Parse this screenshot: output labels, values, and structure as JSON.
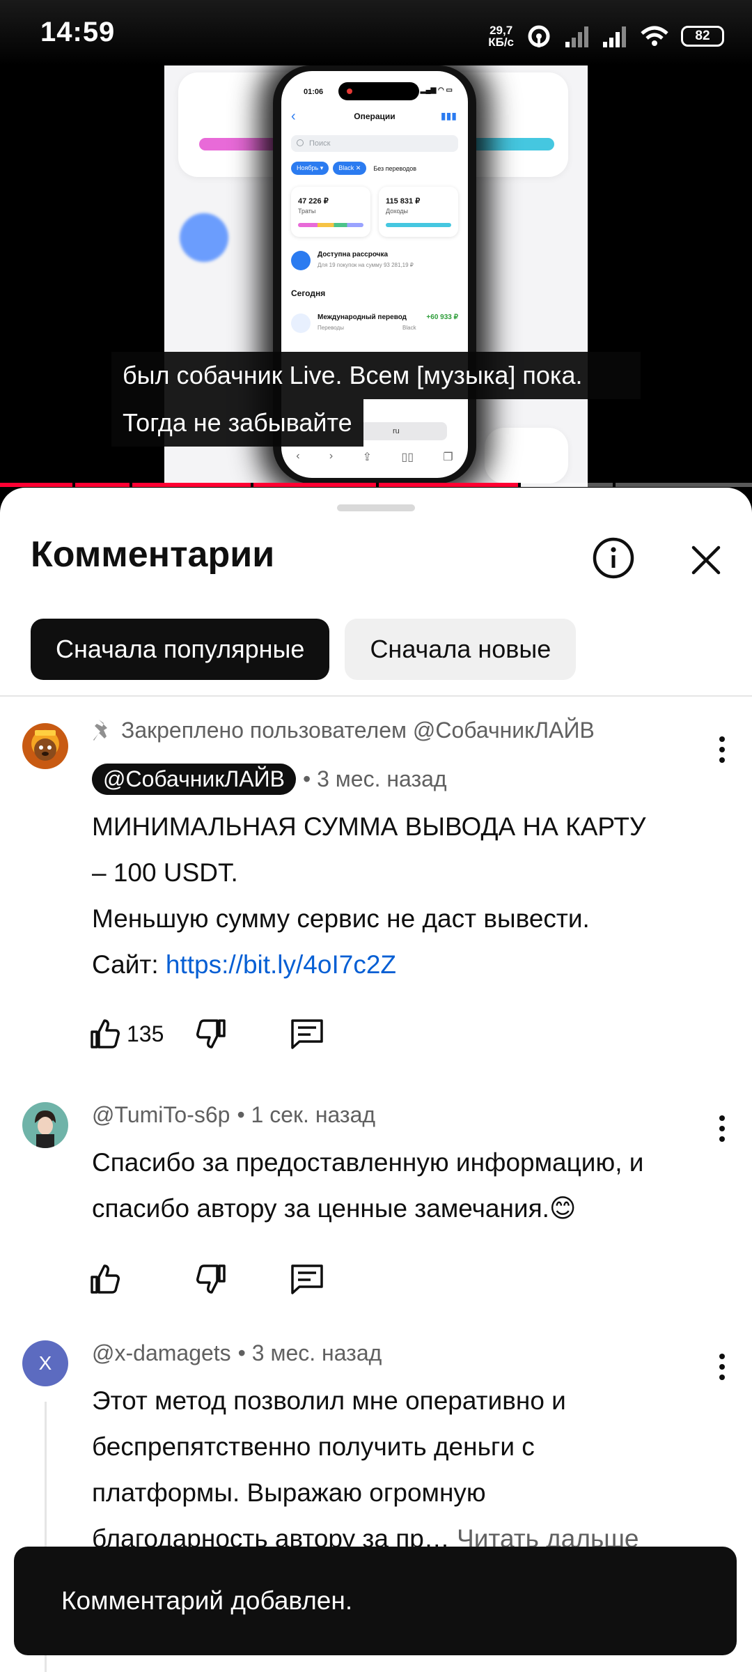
{
  "status_bar": {
    "time": "14:59",
    "net_speed_value": "29,7",
    "net_speed_unit": "КБ/с",
    "battery": "82"
  },
  "video": {
    "phone": {
      "time": "01:06",
      "title": "Операции",
      "search_placeholder": "Поиск",
      "chips": [
        "Ноябрь ▾",
        "Black ✕"
      ],
      "chip_plain": "Без переводов",
      "card_spend_value": "47 226 ₽",
      "card_spend_label": "Траты",
      "card_income_value": "115 831 ₽",
      "card_income_label": "Доходы",
      "installment_title": "Доступна рассрочка",
      "installment_sub": "Для 19 покупок на сумму 93 281,19 ₽",
      "section_today": "Сегодня",
      "transfer_title": "Международный перевод",
      "transfer_sub": "Переводы",
      "transfer_amount": "+60 933 ₽",
      "transfer_card": "Black",
      "url_text": "ru"
    },
    "subtitle_line1": "был собачник Live. Всем [музыка] пока.",
    "subtitle_line2": "Тогда не забывайте",
    "progress_fraction": 0.69
  },
  "comments_sheet": {
    "title": "Комментарии",
    "sort_chips": [
      {
        "label": "Сначала популярные",
        "active": true
      },
      {
        "label": "Сначала новые",
        "active": false
      }
    ],
    "comments": [
      {
        "pinned_text": "Закреплено пользователем @СобачникЛАЙВ",
        "author": "@СобачникЛАЙВ",
        "time": "• 3 мес. назад",
        "text_line1": "МИНИМАЛЬНАЯ СУММА ВЫВОДА НА КАРТУ",
        "text_line2": "– 100 USDT.",
        "text_line3": "Меньшую сумму сервис не даст вывести.",
        "site_label": "Сайт: ",
        "site_link": "https://bit.ly/4oI7c2Z",
        "likes": "135"
      },
      {
        "author": "@TumiTo-s6p",
        "time": "• 1 сек. назад",
        "text_line1": "Спасибо за предоставленную информацию, и",
        "text_line2": "спасибо автору за ценные замечания.😊"
      },
      {
        "avatar_letter": "X",
        "author": "@x-damagets",
        "time": "• 3 мес. назад",
        "text_line1": "Этот метод позволил мне оперативно и",
        "text_line2": "беспрепятственно получить деньги с",
        "text_line3": "платформы. Выражаю огромную",
        "text_line4": "благодарность автору за пр…",
        "read_more": "Читать дальше"
      }
    ]
  },
  "snackbar": {
    "text": "Комментарий добавлен."
  },
  "colors": {
    "accent_red": "#ff0033",
    "link_blue": "#065fd4",
    "avatar_x_bg": "#5c6bc0"
  }
}
